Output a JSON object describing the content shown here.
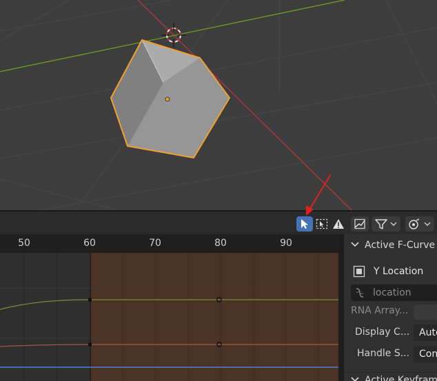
{
  "viewport": {
    "colors": {
      "background": "#3d3d3d",
      "x_axis": "#b0373e",
      "y_axis": "#6c9a25",
      "selection_outline": "#f0a030"
    }
  },
  "graph_editor": {
    "header_icons": [
      "select-tool-icon",
      "box-select-icon",
      "warning-icon",
      "normalize-icon",
      "filter-icon",
      "proportional-editing-icon"
    ],
    "ruler_labels": [
      "50",
      "60",
      "70",
      "80",
      "90"
    ],
    "colors": {
      "active_button": "#4772b3",
      "preview_range": "#4a3324",
      "curve_green": "#7a8a3e",
      "curve_red": "#a0574a",
      "current_frame_line": "#4a7fd6"
    }
  },
  "sidebar": {
    "panel_title": "Active F-Curve",
    "curve_name": "Y Location",
    "data_path": "location",
    "rna_array_label": "RNA Array...",
    "display_color_label": "Display C...",
    "display_color_value": "Auto",
    "handle_smoothing_label": "Handle S...",
    "handle_smoothing_value": "Con",
    "next_panel_title": "Active Keyframe"
  }
}
